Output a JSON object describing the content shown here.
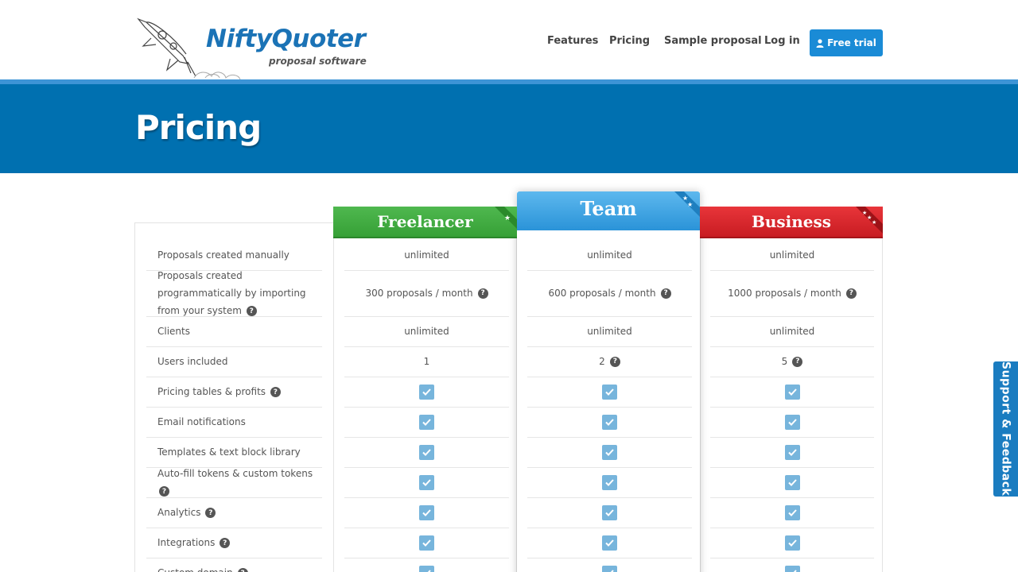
{
  "brand": {
    "name": "NiftyQuoter",
    "tagline": "proposal software"
  },
  "nav": {
    "items": [
      {
        "label": "Features"
      },
      {
        "label": "Pricing"
      },
      {
        "label": "Sample proposal"
      },
      {
        "label": "Log in"
      }
    ],
    "cta": "Free trial"
  },
  "hero": {
    "title": "Pricing"
  },
  "plans": [
    {
      "name": "Freelancer",
      "stars": 1,
      "color": "#3fa93f"
    },
    {
      "name": "Team",
      "stars": 2,
      "color": "#3aa0e0"
    },
    {
      "name": "Business",
      "stars": 3,
      "color": "#d9252b"
    }
  ],
  "features": [
    {
      "label": "Proposals created manually",
      "help": false,
      "values": [
        "unlimited",
        "unlimited",
        "unlimited"
      ],
      "help_values": [
        false,
        false,
        false
      ]
    },
    {
      "label": "Proposals created programmatically by importing from your system",
      "help": true,
      "values": [
        "300 proposals / month",
        "600 proposals / month",
        "1000 proposals / month"
      ],
      "help_values": [
        true,
        true,
        true
      ]
    },
    {
      "label": "Clients",
      "help": false,
      "values": [
        "unlimited",
        "unlimited",
        "unlimited"
      ],
      "help_values": [
        false,
        false,
        false
      ]
    },
    {
      "label": "Users included",
      "help": false,
      "values": [
        "1",
        "2",
        "5"
      ],
      "help_values": [
        false,
        true,
        true
      ]
    },
    {
      "label": "Pricing tables & profits",
      "help": true,
      "values": [
        "check",
        "check",
        "check"
      ]
    },
    {
      "label": "Email notifications",
      "help": false,
      "values": [
        "check",
        "check",
        "check"
      ]
    },
    {
      "label": "Templates & text block library",
      "help": false,
      "values": [
        "check",
        "check",
        "check"
      ]
    },
    {
      "label": "Auto-fill tokens & custom tokens",
      "help": true,
      "values": [
        "check",
        "check",
        "check"
      ]
    },
    {
      "label": "Analytics",
      "help": true,
      "values": [
        "check",
        "check",
        "check"
      ]
    },
    {
      "label": "Integrations",
      "help": true,
      "values": [
        "check",
        "check",
        "check"
      ]
    },
    {
      "label": "Custom domain",
      "help": true,
      "values": [
        "check",
        "check",
        "check"
      ]
    }
  ],
  "support_tab": "Support & Feedback",
  "help_glyph": "?"
}
